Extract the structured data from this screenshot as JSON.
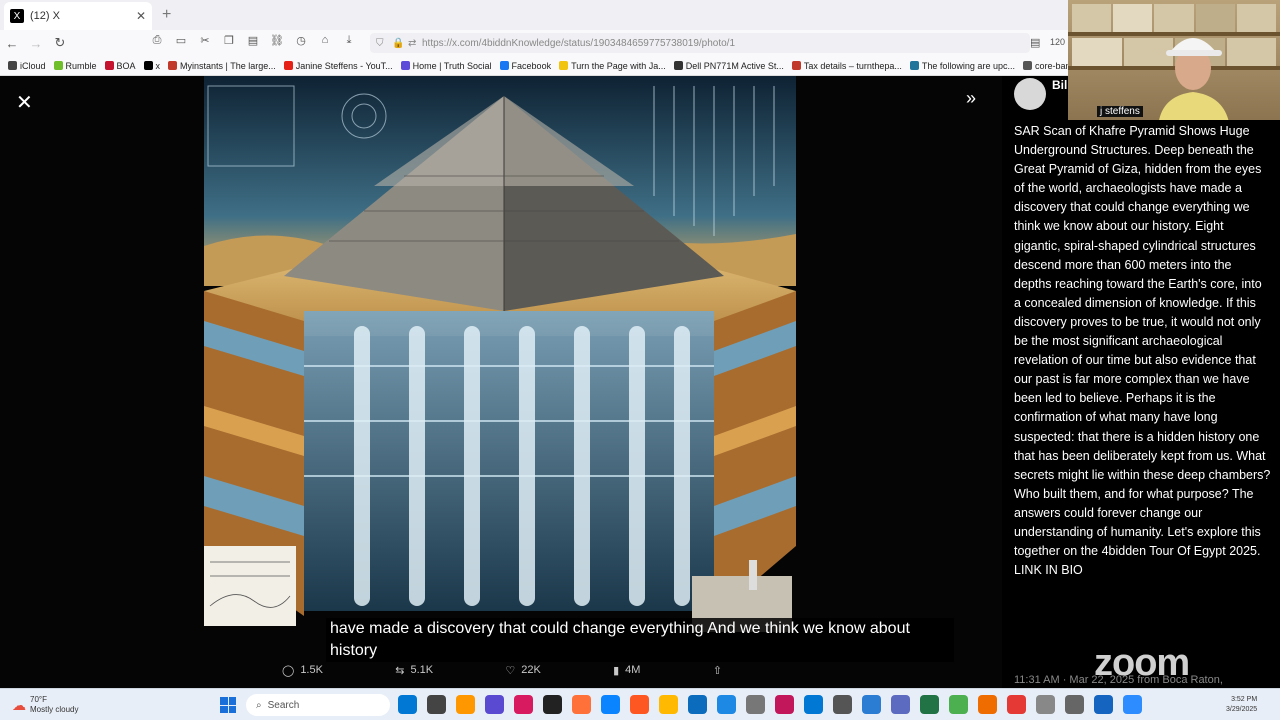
{
  "browser": {
    "tab_title": "(12) X",
    "tab_logo": "X",
    "new_tab": "+",
    "url": "https://x.com/4biddnKnowledge/status/1903484659775738019/photo/1",
    "zoom_level": "120",
    "bookmarks": [
      {
        "label": "iCloud",
        "color": "#444"
      },
      {
        "label": "Rumble",
        "color": "#6fbf2b"
      },
      {
        "label": "BOA",
        "color": "#c4122f"
      },
      {
        "label": "x",
        "color": "#000"
      },
      {
        "label": "Myinstants | The large...",
        "color": "#c0392b"
      },
      {
        "label": "Janine Steffens - YouT...",
        "color": "#e62117"
      },
      {
        "label": "Home | Truth Social",
        "color": "#5c4bd8"
      },
      {
        "label": "Facebook",
        "color": "#1877f2"
      },
      {
        "label": "Turn the Page with Ja...",
        "color": "#f1c40f"
      },
      {
        "label": "Dell PN771M Active St...",
        "color": "#333"
      },
      {
        "label": "Tax details – turnthepa...",
        "color": "#c0392b"
      },
      {
        "label": "The following are upc...",
        "color": "#21759b"
      },
      {
        "label": "core-banking-system-...",
        "color": "#555"
      }
    ]
  },
  "viewer": {
    "close_icon": "✕",
    "next_icon": "»"
  },
  "tweet": {
    "author": "Bil",
    "text": "SAR Scan of Khafre Pyramid Shows Huge Underground Structures. Deep beneath the Great Pyramid of Giza, hidden from the eyes of the world, archaeologists have made a discovery that could change everything we think we know about our history. Eight gigantic, spiral-shaped cylindrical structures descend more than 600 meters into the depths reaching toward the Earth's core, into a concealed dimension of knowledge. If this discovery proves to be true, it would not only be the most significant archaeological revelation of our time but also evidence that our past is far more complex than we have been led to believe. Perhaps it is the confirmation of what many have long suspected: that there is a hidden history one that has been deliberately kept from us. What secrets might lie within these deep chambers? Who built them, and for what purpose? The answers could forever change our understanding of humanity. Let's explore this together on the 4bidden Tour Of Egypt 2025. LINK IN BIO",
    "meta": "11:31 AM · Mar 22, 2025 from Boca Raton,",
    "actions": {
      "replies": "1.5K",
      "reposts": "5.1K",
      "likes": "22K",
      "views": "4M"
    }
  },
  "webcam": {
    "name": "j steffens"
  },
  "zoom_logo": "zoom",
  "caption": "have made a discovery that could change everything And we think we know about history",
  "taskbar": {
    "weather_temp": "70°F",
    "weather_desc": "Mostly cloudy",
    "search_placeholder": "Search",
    "time": "3:52 PM",
    "date": "3/29/2025",
    "apps": [
      "#0078d4",
      "#444",
      "#ff9800",
      "#5a4ad1",
      "#d81b60",
      "#222",
      "#ff7139",
      "#0a84ff",
      "#ff5722",
      "#ffb900",
      "#0b6cbd",
      "#1e88e5",
      "#777",
      "#c2185b",
      "#0078d4",
      "#555",
      "#2b7cd3",
      "#5c6bc0",
      "#217346",
      "#4caf50",
      "#ef6c00",
      "#e53935",
      "#888",
      "#666",
      "#1565c0",
      "#2d8cff"
    ]
  }
}
